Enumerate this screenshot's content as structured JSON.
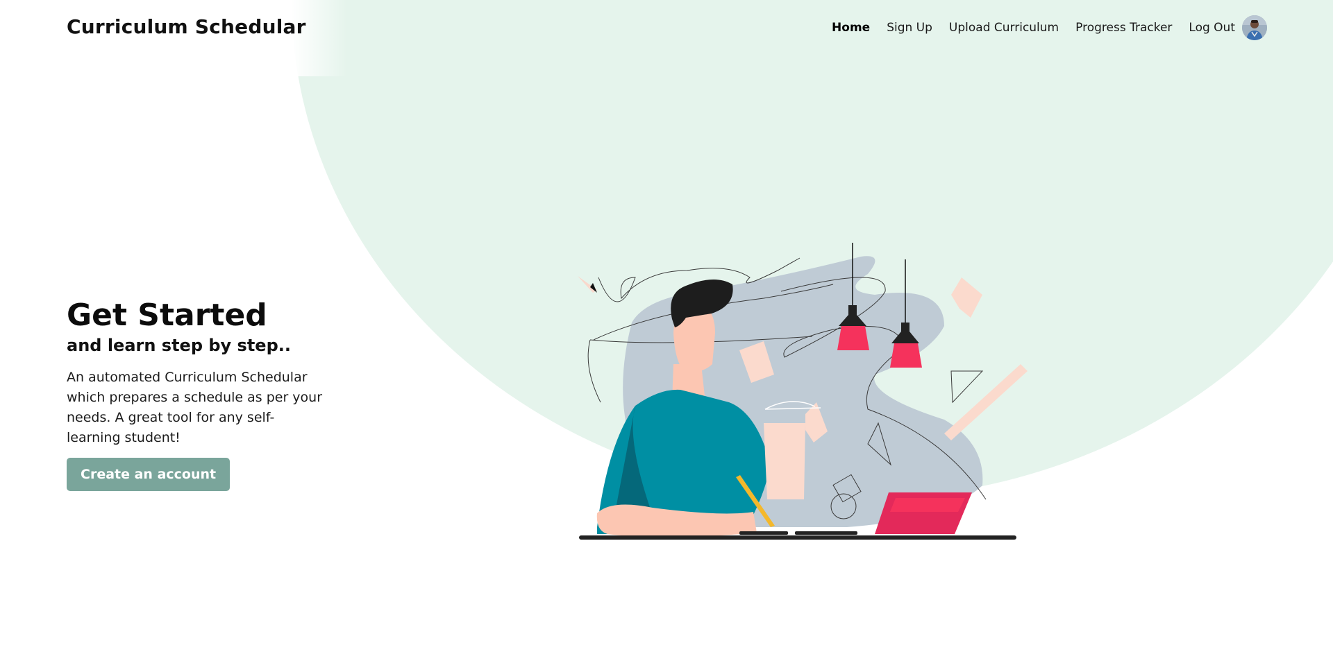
{
  "header": {
    "logo": "Curriculum Schedular",
    "nav": {
      "home": "Home",
      "signup": "Sign Up",
      "upload": "Upload Curriculum",
      "progress": "Progress Tracker",
      "logout": "Log Out"
    }
  },
  "hero": {
    "title": "Get Started",
    "subtitle": "and learn step by step..",
    "description": "An automated Curriculum Schedular which prepares a schedule as per your needs. A great tool for any self-learning student!",
    "cta_label": "Create an account"
  },
  "theme": {
    "accent": "#7aa59b",
    "background_circle": "#e5f4ec",
    "illustration_teal": "#008fa3",
    "illustration_pink": "#f5325c",
    "illustration_blob": "#bfcbd5"
  },
  "icons": {
    "avatar": "user-avatar-photo",
    "illustration": "student-studying-at-desk-illustration"
  }
}
